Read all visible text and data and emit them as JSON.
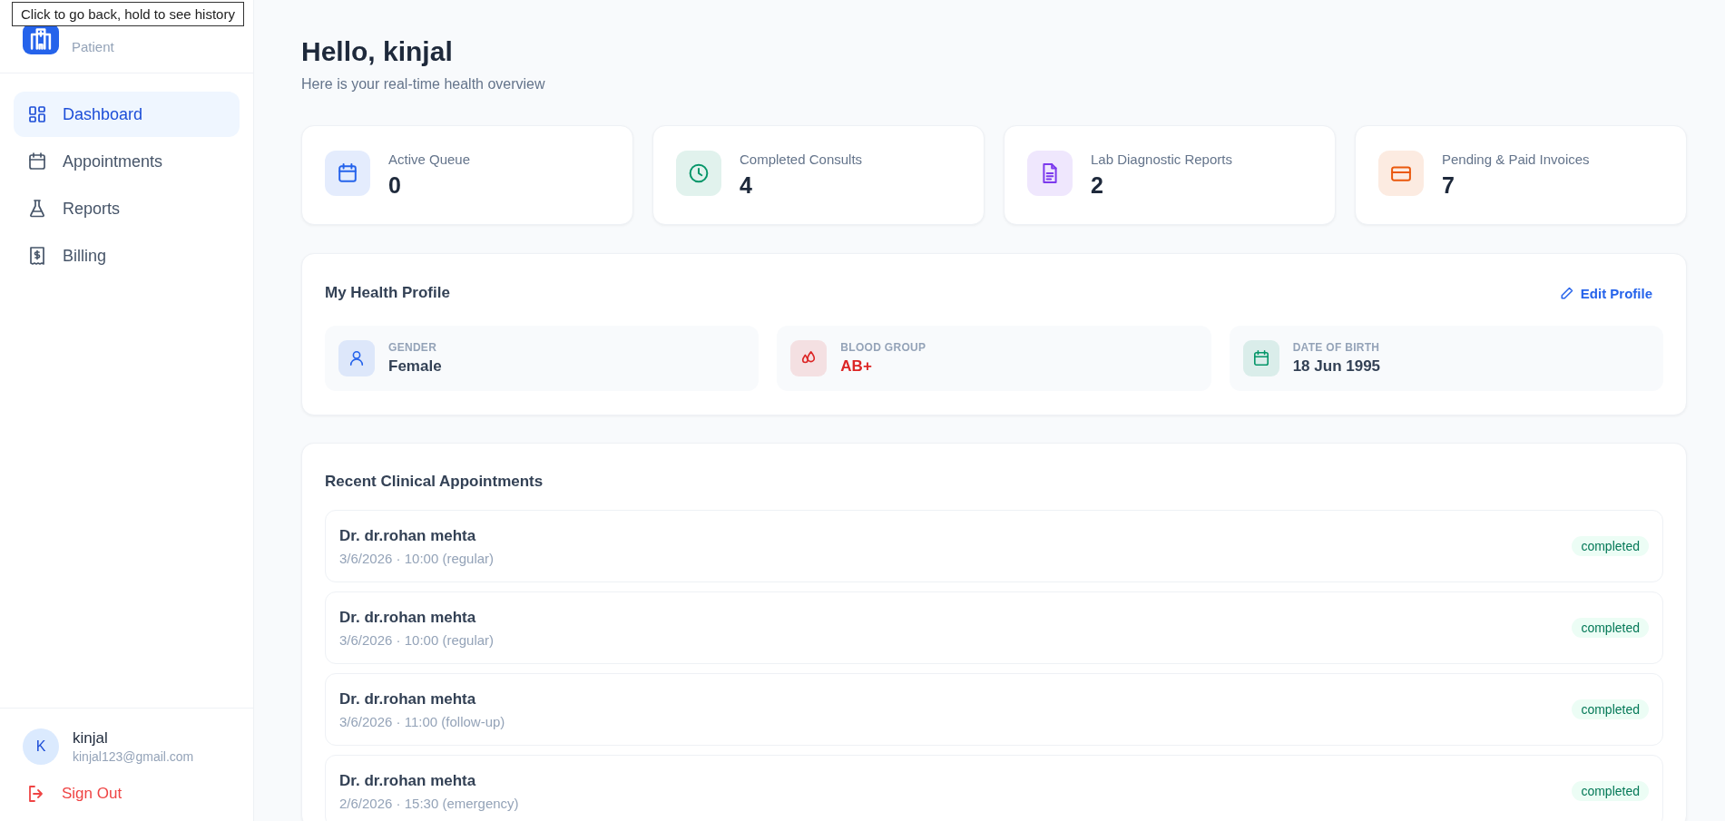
{
  "tooltip": "Click to go back, hold to see history",
  "brand": {
    "role": "Patient"
  },
  "nav": [
    {
      "label": "Dashboard",
      "selected": true
    },
    {
      "label": "Appointments",
      "selected": false
    },
    {
      "label": "Reports",
      "selected": false
    },
    {
      "label": "Billing",
      "selected": false
    }
  ],
  "user": {
    "initial": "K",
    "name": "kinjal",
    "email": "kinjal123@gmail.com"
  },
  "sign_out": "Sign Out",
  "greeting": "Hello, kinjal",
  "subtitle": "Here is your real-time health overview",
  "stats": [
    {
      "label": "Active Queue",
      "value": "0",
      "color": "#2563eb"
    },
    {
      "label": "Completed Consults",
      "value": "4",
      "color": "#059669"
    },
    {
      "label": "Lab Diagnostic Reports",
      "value": "2",
      "color": "#7c3aed"
    },
    {
      "label": "Pending & Paid Invoices",
      "value": "7",
      "color": "#ea580c"
    }
  ],
  "profile": {
    "title": "My Health Profile",
    "edit": "Edit Profile",
    "fields": [
      {
        "label": "GENDER",
        "value": "Female",
        "color": "#2563eb"
      },
      {
        "label": "BLOOD GROUP",
        "value": "AB+",
        "color": "#dc2626"
      },
      {
        "label": "DATE OF BIRTH",
        "value": "18 Jun 1995",
        "color": "#059669"
      }
    ]
  },
  "appointments": {
    "title": "Recent Clinical Appointments",
    "rows": [
      {
        "doctor": "Dr. dr.rohan mehta",
        "detail": "3/6/2026 · 10:00 (regular)",
        "status": "completed"
      },
      {
        "doctor": "Dr. dr.rohan mehta",
        "detail": "3/6/2026 · 10:00 (regular)",
        "status": "completed"
      },
      {
        "doctor": "Dr. dr.rohan mehta",
        "detail": "3/6/2026 · 11:00 (follow-up)",
        "status": "completed"
      },
      {
        "doctor": "Dr. dr.rohan mehta",
        "detail": "2/6/2026 · 15:30 (emergency)",
        "status": "completed"
      }
    ]
  }
}
